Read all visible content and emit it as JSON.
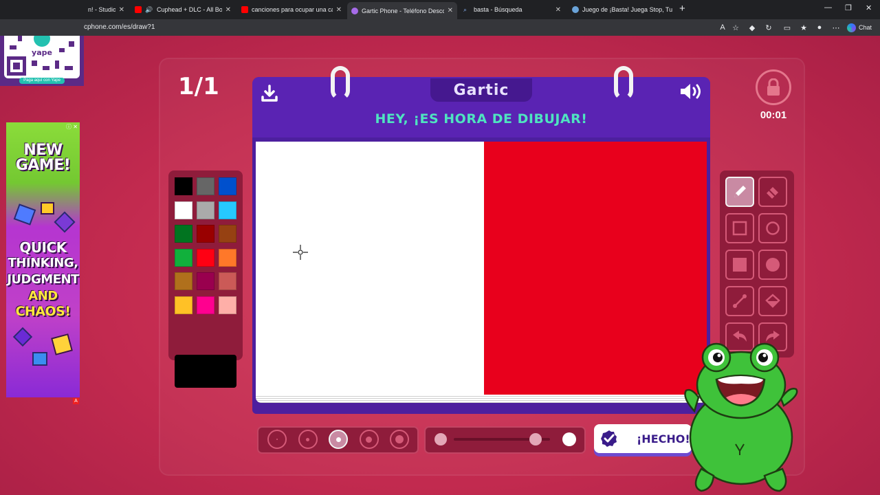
{
  "browser": {
    "tabs": [
      {
        "title": "n! - Studiop",
        "favicon_color": "#6b6b6b"
      },
      {
        "title": "Cuphead + DLC - All Bosses S",
        "favicon_color": "#ff0000"
      },
      {
        "title": "canciones para ocupar una cabeza",
        "favicon_color": "#ff0000"
      },
      {
        "title": "Gartic Phone - Teléfono Descomp",
        "favicon_color": "#a66be8"
      },
      {
        "title": "basta - Búsqueda",
        "favicon_color": "#4a90e2"
      },
      {
        "title": "Juego de ¡Basta! Juega Stop, Tutti",
        "favicon_color": "#6aa3d8"
      }
    ],
    "new_tab": "+",
    "window_controls": {
      "minimize": "—",
      "maximize": "❐",
      "close": "✕"
    },
    "url": "cphone.com/es/draw?1",
    "chat_label": "Chat"
  },
  "qr_ad": {
    "caption": "Paga aquí con Yape",
    "brand": "yape"
  },
  "side_ad": {
    "headline1": "NEW",
    "headline2": "GAME!",
    "line1": "QUICK",
    "line2": "THINKING,",
    "line3": "JUDGMENT",
    "line4": "AND",
    "line5": "CHAOS!",
    "info": "ⓘ ✕",
    "choice": "A"
  },
  "game": {
    "round": "1/1",
    "timer": "00:01",
    "logo": "Gartic",
    "prompt": "HEY, ¡ES HORA DE DIBUJAR!",
    "done_label": "¡HECHO!",
    "current_color": "#000000",
    "palette": [
      "#000000",
      "#666666",
      "#0050cd",
      "#ffffff",
      "#aaaaaa",
      "#26c9ff",
      "#017420",
      "#990000",
      "#964112",
      "#11b03c",
      "#ff0013",
      "#ff7829",
      "#b0701c",
      "#99004e",
      "#cb5a57",
      "#ffc126",
      "#ff008f",
      "#feafa8"
    ],
    "brush_sizes": {
      "count": 5,
      "selected": 2
    },
    "opacity": {
      "value": 0.85
    },
    "canvas": {
      "left_color": "#ffffff",
      "right_color": "#e8001c",
      "split_fraction": 0.506
    },
    "tools": [
      "pencil-icon",
      "eraser-icon",
      "rectangle-outline-icon",
      "circle-outline-icon",
      "rectangle-filled-icon",
      "circle-filled-icon",
      "line-icon",
      "fill-bucket-icon",
      "undo-icon",
      "redo-icon"
    ],
    "active_tool": "pencil-icon"
  }
}
